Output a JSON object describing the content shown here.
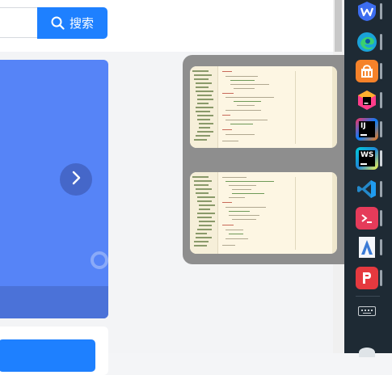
{
  "search": {
    "input_value": "",
    "button_label": "搜索",
    "icon": "search-icon"
  },
  "banner": {
    "next_icon": "chevron-right-icon",
    "indicator_icon": "ring-indicator"
  },
  "preview": {
    "thumbnails": [
      {
        "kind": "code-editor-window"
      },
      {
        "kind": "code-editor-window"
      }
    ]
  },
  "taskbar": {
    "items": [
      {
        "icon": "wps-icon",
        "color": "#3c6df0"
      },
      {
        "icon": "edge-icon",
        "color": "#1aa2d8"
      },
      {
        "icon": "store-bag-icon",
        "color": "#f5822a"
      },
      {
        "icon": "jetbrains-toolbox-icon",
        "color": "#ff3d8b"
      },
      {
        "icon": "intellij-idea-icon",
        "color": "#000000"
      },
      {
        "icon": "webstorm-icon",
        "color": "#00cdd7"
      },
      {
        "icon": "vscode-icon",
        "color": "#2489ca"
      },
      {
        "icon": "terminal-icon",
        "color": "#e53b5a"
      },
      {
        "icon": "arc-app-icon",
        "color": "#3b7bd6"
      },
      {
        "icon": "wps-presentation-icon",
        "color": "#e5393f"
      }
    ],
    "keyboard_icon": "keyboard-icon",
    "labels": {
      "webstorm": "WS",
      "intellij": "IJ"
    }
  },
  "colors": {
    "accent": "#1e80ff",
    "banner": "#5684f7",
    "taskbar": "#1e2a34",
    "preview_popup": "#8e8e8e",
    "editor_bg": "#fdf6e3"
  }
}
